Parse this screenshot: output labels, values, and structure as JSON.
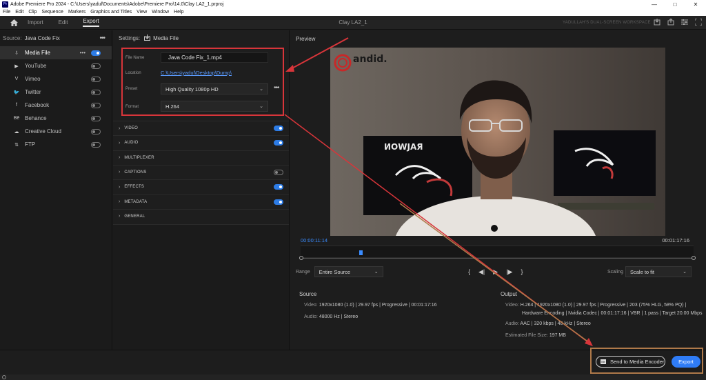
{
  "titlebar": {
    "app_icon": "Pr",
    "title": "Adobe Premiere Pro 2024 - C:\\Users\\yadul\\Documents\\Adobe\\Premiere Pro\\14.0\\Clay LA2_1.prproj",
    "minimize": "—",
    "maximize": "□",
    "close": "✕"
  },
  "menu": [
    "File",
    "Edit",
    "Clip",
    "Sequence",
    "Markers",
    "Graphics and Titles",
    "View",
    "Window",
    "Help"
  ],
  "header": {
    "tabs": [
      "Import",
      "Edit",
      "Export"
    ],
    "project_title": "Clay LA2_1",
    "workspace": "YADULLAH'S DUAL-SCREEN WORKSPACE"
  },
  "source": {
    "label": "Source:",
    "value": "Java Code Fix",
    "more": "•••"
  },
  "destinations": [
    {
      "name": "Media File",
      "icon": "export-file-icon",
      "glyph": "⇩",
      "active": true,
      "on": true,
      "more": "•••"
    },
    {
      "name": "YouTube",
      "icon": "youtube-icon",
      "glyph": "▶",
      "active": false,
      "on": false
    },
    {
      "name": "Vimeo",
      "icon": "vimeo-icon",
      "glyph": "V",
      "active": false,
      "on": false
    },
    {
      "name": "Twitter",
      "icon": "twitter-icon",
      "glyph": "🐦",
      "active": false,
      "on": false
    },
    {
      "name": "Facebook",
      "icon": "facebook-icon",
      "glyph": "f",
      "active": false,
      "on": false
    },
    {
      "name": "Behance",
      "icon": "behance-icon",
      "glyph": "Bē",
      "active": false,
      "on": false
    },
    {
      "name": "Creative Cloud",
      "icon": "creative-cloud-icon",
      "glyph": "☁",
      "active": false,
      "on": false
    },
    {
      "name": "FTP",
      "icon": "ftp-icon",
      "glyph": "⇅",
      "active": false,
      "on": false
    }
  ],
  "settings": {
    "label": "Settings:",
    "value": "Media File",
    "file_name_label": "File Name",
    "file_name": "Java Code Fix_1.mp4",
    "location_label": "Location",
    "location": "C:\\Users\\yadul\\Desktop\\Dump\\",
    "preset_label": "Preset",
    "preset": "High Quality 1080p HD",
    "preset_more": "•••",
    "format_label": "Format",
    "format": "H.264",
    "sections": [
      {
        "name": "VIDEO",
        "toggle": "on"
      },
      {
        "name": "AUDIO",
        "toggle": "on"
      },
      {
        "name": "MULTIPLEXER",
        "toggle": "none"
      },
      {
        "name": "CAPTIONS",
        "toggle": "off"
      },
      {
        "name": "EFFECTS",
        "toggle": "on"
      },
      {
        "name": "METADATA",
        "toggle": "on"
      },
      {
        "name": "GENERAL",
        "toggle": "none"
      }
    ]
  },
  "preview": {
    "label": "Preview",
    "logo_text": "andid.",
    "current_time": "00:00:11:14",
    "duration": "00:01:17:16",
    "range_label": "Range",
    "range_value": "Entire Source",
    "scaling_label": "Scaling",
    "scaling_value": "Scale to fit",
    "playhead_fraction": 0.149
  },
  "source_info": {
    "title": "Source",
    "video_label": "Video:",
    "video": "1920x1080 (1.0)  |  29.97 fps  |  Progressive  |  00:01:17:16",
    "audio_label": "Audio:",
    "audio": "48000 Hz  |  Stereo"
  },
  "output_info": {
    "title": "Output",
    "video_label": "Video:",
    "video_line1": "H.264  |  1920x1080 (1.0)  |  29.97 fps  |  Progressive  |  203 (75% HLG, 58% PQ)  |",
    "video_line2": "Hardware Encoding  |  Nvidia Codec  |  00:01:17:16  |  VBR  |  1 pass  |  Target 20.00 Mbps",
    "audio_label": "Audio:",
    "audio": "AAC  |  320 kbps  |  48 kHz  |  Stereo",
    "size_label": "Estimated File Size:",
    "size": "197 MB"
  },
  "bottom": {
    "media_encoder_label": "Send to Media Encoder",
    "media_encoder_icon": "Me",
    "export_label": "Export"
  },
  "colors": {
    "accent": "#2f7cf6",
    "annotation_red": "#d8353a",
    "annotation_tan": "#b07a4a"
  }
}
